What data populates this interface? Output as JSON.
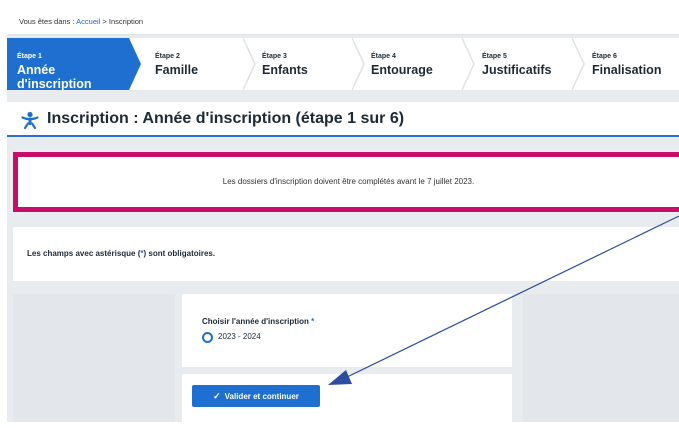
{
  "breadcrumb": {
    "prefix": "Vous êtes dans :",
    "home": "Accueil",
    "separator": ">",
    "current": "Inscription"
  },
  "steps": [
    {
      "number": "Étape 1",
      "label": "Année d'inscription",
      "active": true
    },
    {
      "number": "Étape 2",
      "label": "Famille",
      "active": false
    },
    {
      "number": "Étape 3",
      "label": "Enfants",
      "active": false
    },
    {
      "number": "Étape 4",
      "label": "Entourage",
      "active": false
    },
    {
      "number": "Étape 5",
      "label": "Justificatifs",
      "active": false
    },
    {
      "number": "Étape 6",
      "label": "Finalisation",
      "active": false
    }
  ],
  "page": {
    "title": "Inscription : Année d'inscription (étape 1 sur 6)",
    "icon": "child-icon"
  },
  "alert": {
    "text": "Les dossiers d'inscription doivent être complétés avant le 7 juillet 2023."
  },
  "info": {
    "before": "Les champs avec astérisque (",
    "asterisk": "*",
    "after": ") sont obligatoires."
  },
  "form": {
    "field_label": "Choisir l'année d'inscription",
    "required_mark": "*",
    "option_label": "2023 - 2024",
    "option_selected": true
  },
  "actions": {
    "submit_label": "Valider et continuer",
    "submit_icon": "check-icon"
  },
  "colors": {
    "accent": "#1f6fd1",
    "alert_border": "#c70d68",
    "annotation_arrow": "#2b4ea0"
  }
}
